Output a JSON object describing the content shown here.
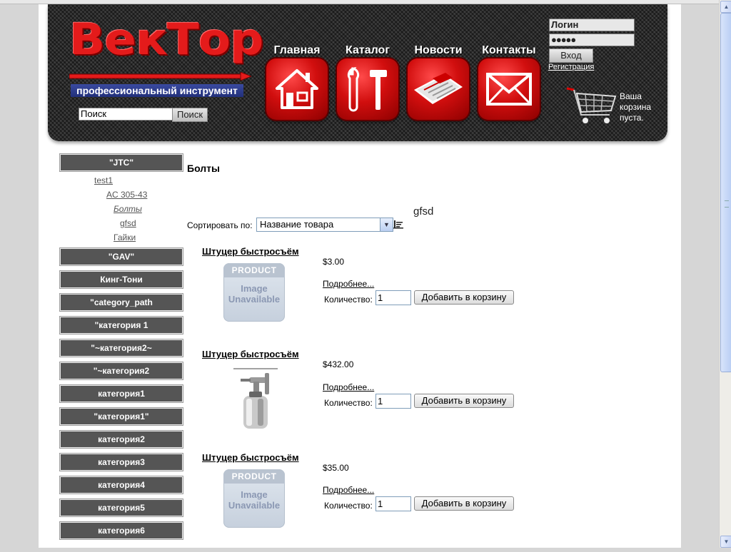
{
  "header": {
    "logo_text": "ВекТор",
    "logo_subtitle": "профессиональный инструмент",
    "search_placeholder": "Поиск",
    "search_button": "Поиск",
    "nav": [
      {
        "label": "Главная",
        "icon": "house-icon"
      },
      {
        "label": "Каталог",
        "icon": "tools-icon"
      },
      {
        "label": "Новости",
        "icon": "newspaper-icon"
      },
      {
        "label": "Контакты",
        "icon": "envelope-icon"
      }
    ],
    "login": {
      "username_value": "Логин",
      "password_value": "●●●●●",
      "login_button": "Вход",
      "register_link": "Регистрация"
    },
    "cart_text": "Ваша корзина пуста."
  },
  "sidebar": {
    "categories": [
      "\"JTC\"",
      "\"GAV\"",
      "Кинг-Тони",
      "\"category_path",
      "\"категория 1",
      "\"~категория2~",
      "\"~категория2",
      "категория1",
      "\"категория1\"",
      "категория2",
      "категория3",
      "категория4",
      "категория5",
      "категория6"
    ],
    "subcategories": [
      "test1",
      "AC 305-43",
      "Болты",
      "gfsd",
      "Гайки"
    ]
  },
  "main": {
    "title": "Болты",
    "subcategory_label": "gfsd",
    "sort_label": "Сортировать по:",
    "sort_value": "Название товара",
    "products": [
      {
        "name": "Штуцер быстросъём",
        "price": "$3.00",
        "more": "Подробнее...",
        "qty_label": "Количество:",
        "qty": "1",
        "add": "Добавить в корзину",
        "image": "unavailable"
      },
      {
        "name": "Штуцер быстросъём",
        "price": "$432.00",
        "more": "Подробнее...",
        "qty_label": "Количество:",
        "qty": "1",
        "add": "Добавить в корзину",
        "image": "spray-gun"
      },
      {
        "name": "Штуцер быстросъём",
        "price": "$35.00",
        "more": "Подробнее...",
        "qty_label": "Количество:",
        "qty": "1",
        "add": "Добавить в корзину",
        "image": "unavailable"
      }
    ],
    "placeholder_image": {
      "top": "PRODUCT",
      "line1": "Image",
      "line2": "Unavailable"
    }
  },
  "colors": {
    "brand_red": "#e41b1b",
    "header_dark": "#2b2b2b",
    "category_bg": "#555555",
    "subtitle_blue": "#2a3a8a"
  }
}
